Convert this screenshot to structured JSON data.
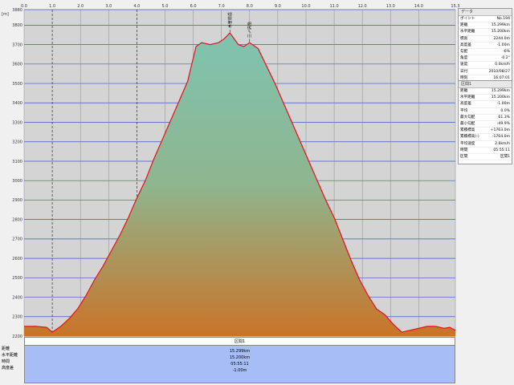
{
  "chart_data": {
    "type": "area",
    "title": "",
    "xlabel": "",
    "ylabel": "",
    "y_unit_label": "[m]",
    "xlim": [
      0,
      15.3
    ],
    "ylim": [
      2200,
      3880
    ],
    "x_ticks": [
      "0.0",
      "1.0",
      "2.0",
      "3.0",
      "4.0",
      "5.0",
      "6.0",
      "7.0",
      "8.0",
      "9.0",
      "10.0",
      "11.0",
      "12.0",
      "13.0",
      "14.0",
      "15.3"
    ],
    "y_ticks": [
      "3880",
      "3800",
      "3700",
      "3600",
      "3500",
      "3400",
      "3300",
      "3200",
      "3100",
      "3000",
      "2900",
      "2800",
      "2700",
      "2600",
      "2500",
      "2400",
      "2300",
      "2200"
    ],
    "grid": true,
    "series": [
      {
        "x": [
          0,
          0.4,
          0.8,
          1.0,
          1.3,
          1.6,
          1.9,
          2.2,
          2.5,
          2.8,
          3.1,
          3.4,
          3.7,
          4.0,
          4.3,
          4.6,
          4.9,
          5.2,
          5.5,
          5.8,
          5.95,
          6.1,
          6.3,
          6.6,
          6.9,
          7.1,
          7.3,
          7.6,
          7.8,
          8.0,
          8.3,
          8.6,
          8.9,
          9.2,
          9.5,
          9.8,
          10.1,
          10.4,
          10.7,
          11.0,
          11.3,
          11.6,
          11.9,
          12.2,
          12.5,
          12.8,
          13.1,
          13.4,
          13.7,
          14.0,
          14.3,
          14.6,
          14.9,
          15.1,
          15.3
        ],
        "y": [
          2250,
          2250,
          2245,
          2220,
          2250,
          2290,
          2340,
          2410,
          2490,
          2560,
          2640,
          2720,
          2810,
          2910,
          3000,
          3110,
          3210,
          3310,
          3410,
          3510,
          3600,
          3690,
          3710,
          3700,
          3710,
          3730,
          3760,
          3700,
          3690,
          3710,
          3680,
          3590,
          3500,
          3400,
          3300,
          3200,
          3100,
          3000,
          2900,
          2810,
          2700,
          2590,
          2490,
          2410,
          2340,
          2310,
          2260,
          2220,
          2230,
          2240,
          2250,
          2250,
          2240,
          2245,
          2230
        ]
      }
    ],
    "annotations": [
      {
        "x": 7.3,
        "y": 3760,
        "text": "木曽前岳"
      },
      {
        "x": 8.0,
        "y": 3710,
        "text": "三ノ沢岳"
      }
    ],
    "colors": {
      "line": "#e8101a",
      "fill_top": "#7ec4b0",
      "fill_bottom": "#c97428",
      "grid": "#4058c8",
      "plot_bg": "#d4d4d4"
    }
  },
  "side_panel": {
    "header": "データ",
    "rows": [
      {
        "k": "ポイント",
        "v": "No.194"
      },
      {
        "k": "距離",
        "v": "15.299km"
      },
      {
        "k": "水平距離",
        "v": "15.200km"
      },
      {
        "k": "標高",
        "v": "2244.0m"
      },
      {
        "k": "高度差",
        "v": "-1.00m"
      },
      {
        "k": "勾配",
        "v": "-6%"
      },
      {
        "k": "角度",
        "v": "-0.2°"
      },
      {
        "k": "速度",
        "v": "0.0km/h"
      },
      {
        "k": "日付",
        "v": "2010/08/27"
      },
      {
        "k": "時刻",
        "v": "16:07:01"
      },
      {
        "k": "経過時間",
        "v": "05:55:11"
      }
    ]
  },
  "section_panel": {
    "header": "区間1",
    "rows": [
      {
        "k": "距離",
        "v": "15.299km"
      },
      {
        "k": "水平距離",
        "v": "15.200km"
      },
      {
        "k": "高度差",
        "v": "-1.00m"
      },
      {
        "k": "平均",
        "v": "0.0%"
      },
      {
        "k": "最大勾配",
        "v": "61.3%"
      },
      {
        "k": "最小勾配",
        "v": "-49.9%"
      },
      {
        "k": "累積標高",
        "v": "+1763.0m"
      },
      {
        "k": "累積標高(-)",
        "v": "-1764.0m"
      },
      {
        "k": "平均速度",
        "v": "2.6km/h"
      },
      {
        "k": "時間",
        "v": "05:55:11"
      },
      {
        "k": "区間",
        "v": "区間1"
      }
    ]
  },
  "summary": {
    "header": "区間1",
    "row_labels": [
      "距離",
      "水平距離",
      "時間",
      "高度差"
    ],
    "values": [
      "15.299km",
      "15.200km",
      "05:55:11",
      "-1.00m"
    ]
  }
}
